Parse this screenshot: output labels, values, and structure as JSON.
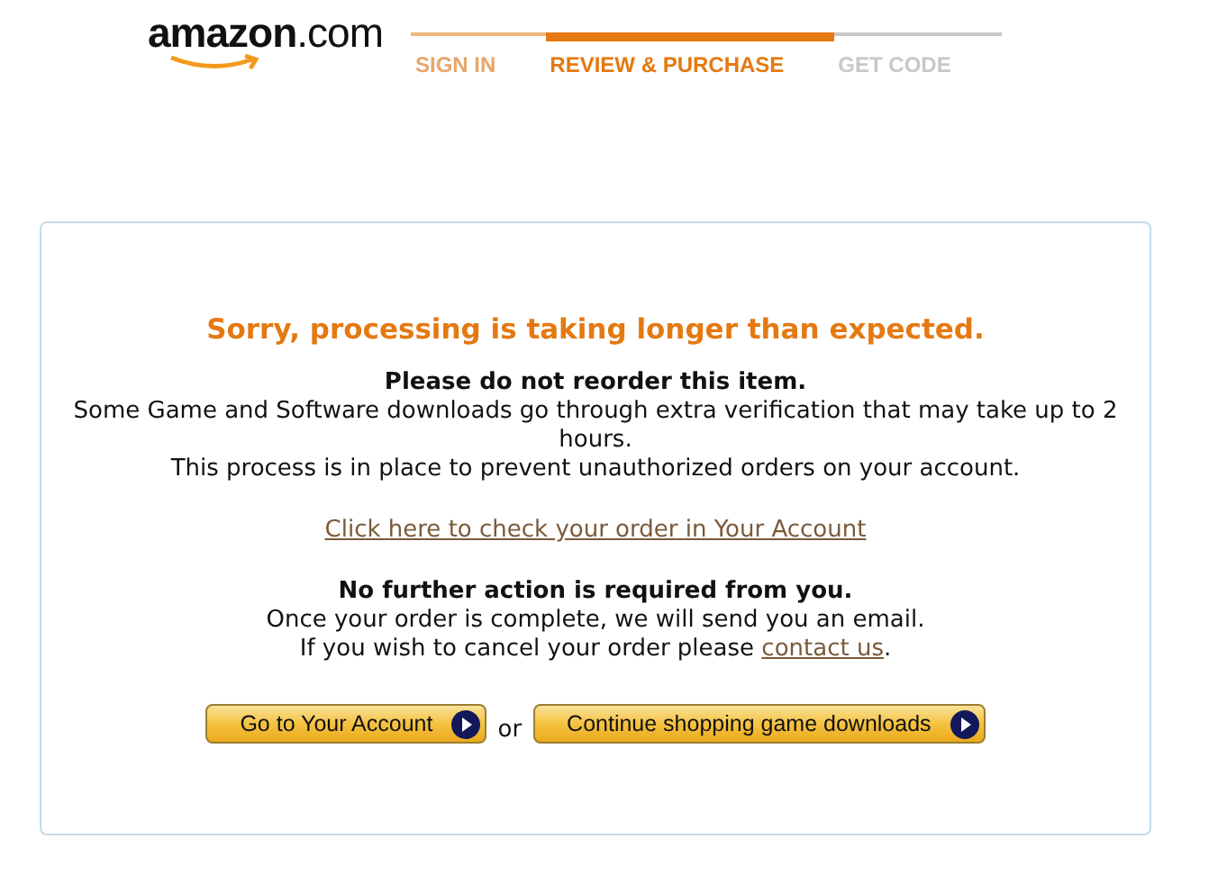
{
  "logo": "**amazon**.com",
  "steps": [
    {
      "label": "SIGN IN",
      "selected": false,
      "completed": true
    },
    {
      "label": "REVIEW & PURCHASE",
      "selected": true,
      "completed": false
    },
    {
      "label": "GET CODE",
      "selected": false,
      "completed": false
    }
  ],
  "message": {
    "heading": "Sorry, processing is taking longer than expected.",
    "notice_title": "Please do not reorder this item.",
    "notice_lines": [
      "Some Game and Software downloads go through extra verification that may take up to 2 hours.",
      "This process is in place to prevent unauthorized orders on your account."
    ],
    "account_link": "Click here to check your order in Your Account",
    "action_title": "No further action is required from you.",
    "action_line": "Once your order is complete, we will send you an email.",
    "cancel_line": {
      "before": "If you wish to cancel your order please ",
      "link": "contact us",
      "after": "."
    }
  },
  "buttons": [
    {
      "label": "Go to Your Account"
    },
    {
      "label": "Continue shopping game downloads"
    }
  ],
  "separator": "or"
}
